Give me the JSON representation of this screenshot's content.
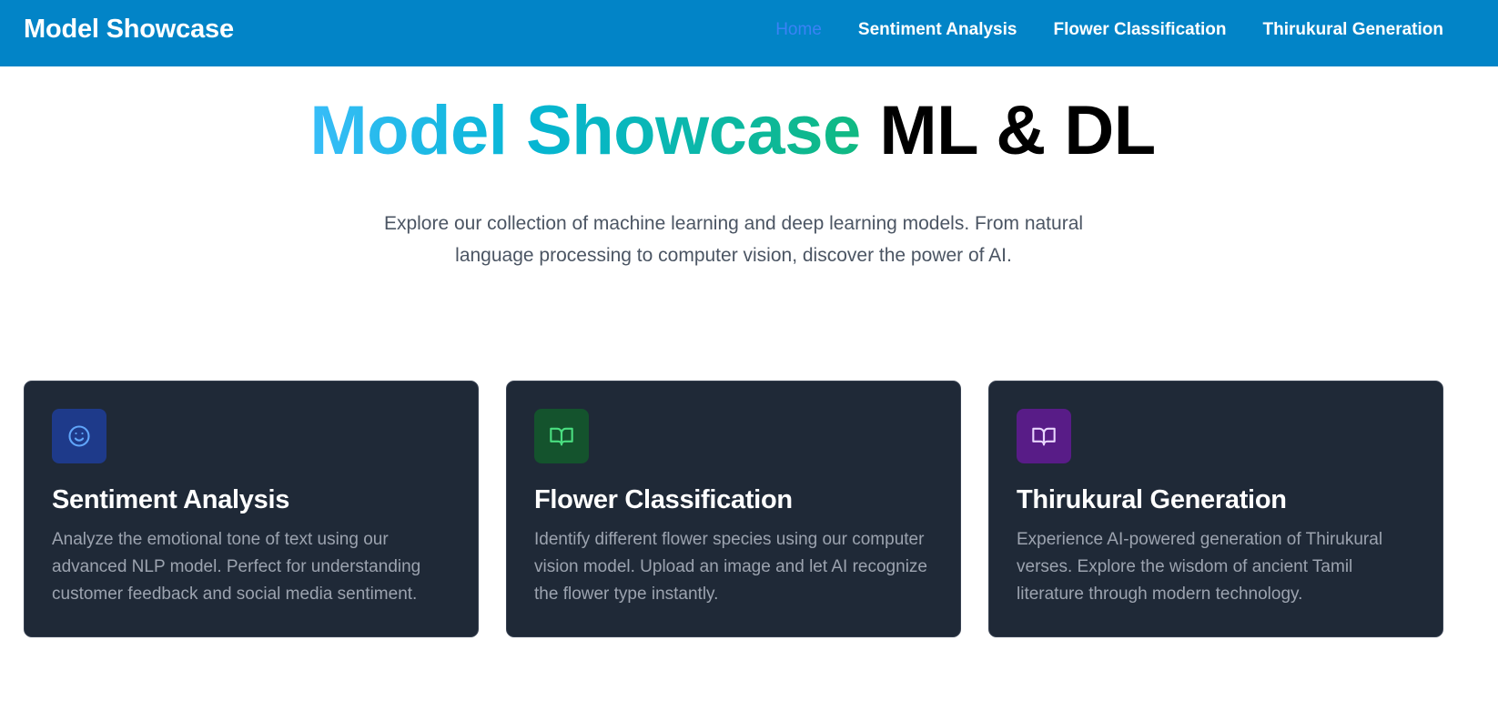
{
  "navbar": {
    "brand": "Model Showcase",
    "links": [
      {
        "label": "Home",
        "active": true
      },
      {
        "label": "Sentiment Analysis",
        "active": false
      },
      {
        "label": "Flower Classification",
        "active": false
      },
      {
        "label": "Thirukural Generation",
        "active": false
      }
    ],
    "background": "#0284c7",
    "active_color": "#3b82f6"
  },
  "hero": {
    "title_gradient": "Model Showcase",
    "title_plain": "ML & DL",
    "subtitle_line1": "Explore our collection of machine learning and deep learning models. From natural",
    "subtitle_line2": "language processing to computer vision, discover the power of AI."
  },
  "cards": [
    {
      "title": "Sentiment Analysis",
      "description": "Analyze the emotional tone of text using our advanced NLP model. Perfect for understanding customer feedback and social media sentiment.",
      "icon": "smile-icon",
      "icon_bg": "#1e3a8a",
      "icon_color": "#60a5fa"
    },
    {
      "title": "Flower Classification",
      "description": "Identify different flower species using our computer vision model. Upload an image and let AI recognize the flower type instantly.",
      "icon": "book-open-icon",
      "icon_bg": "#14532d",
      "icon_color": "#4ade80"
    },
    {
      "title": "Thirukural Generation",
      "description": "Experience AI-powered generation of Thirukural verses. Explore the wisdom of ancient Tamil literature through modern technology.",
      "icon": "book-open-icon",
      "icon_bg": "#581c87",
      "icon_color": "#e9d5ff"
    }
  ]
}
